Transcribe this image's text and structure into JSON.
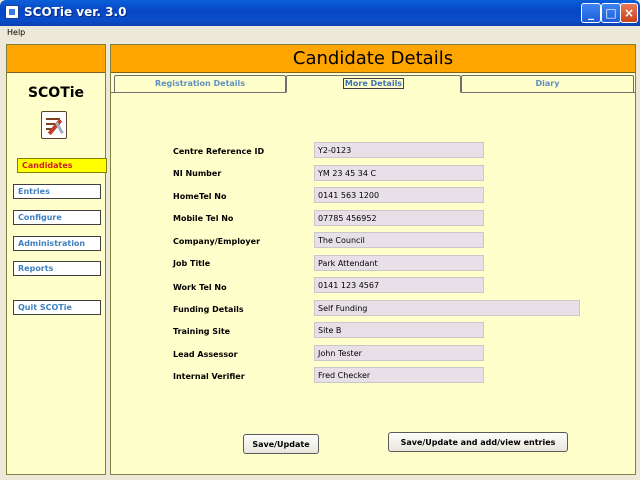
{
  "window": {
    "title": "SCOTie ver. 3.0",
    "controls": [
      "_",
      "□",
      "×"
    ]
  },
  "menu": {
    "items": [
      "Help"
    ]
  },
  "sidebar": {
    "brand": "SCOTie",
    "nav": [
      "Candidates",
      "Entries",
      "Configure",
      "Administration",
      "Reports",
      "Quit SCOTie"
    ],
    "active": "Candidates"
  },
  "main": {
    "title": "Candidate Details",
    "tabs": [
      "Registration Details",
      "More Details",
      "Diary"
    ],
    "active_tab": "More Details"
  },
  "form": {
    "rows": [
      {
        "label": "Centre Reference ID",
        "value": "Y2-0123"
      },
      {
        "label": "NI Number",
        "value": "YM 23 45 34 C"
      },
      {
        "label": "HomeTel No",
        "value": "0141 563 1200"
      },
      {
        "label": "Mobile Tel No",
        "value": "07785 456952"
      },
      {
        "label": "Company/Employer",
        "value": "The Council"
      },
      {
        "label": "Job Title",
        "value": "Park Attendant"
      },
      {
        "label": "Work Tel No",
        "value": "0141 123 4567"
      },
      {
        "label": "Funding Details",
        "value": "Self Funding"
      },
      {
        "label": "Training Site",
        "value": "Site B"
      },
      {
        "label": "Lead Assessor",
        "value": "John Tester"
      },
      {
        "label": "Internal Verifier",
        "value": "Fred Checker"
      }
    ]
  },
  "buttons": {
    "save": "Save/Update",
    "save_entries": "Save/Update and add/view entries"
  }
}
